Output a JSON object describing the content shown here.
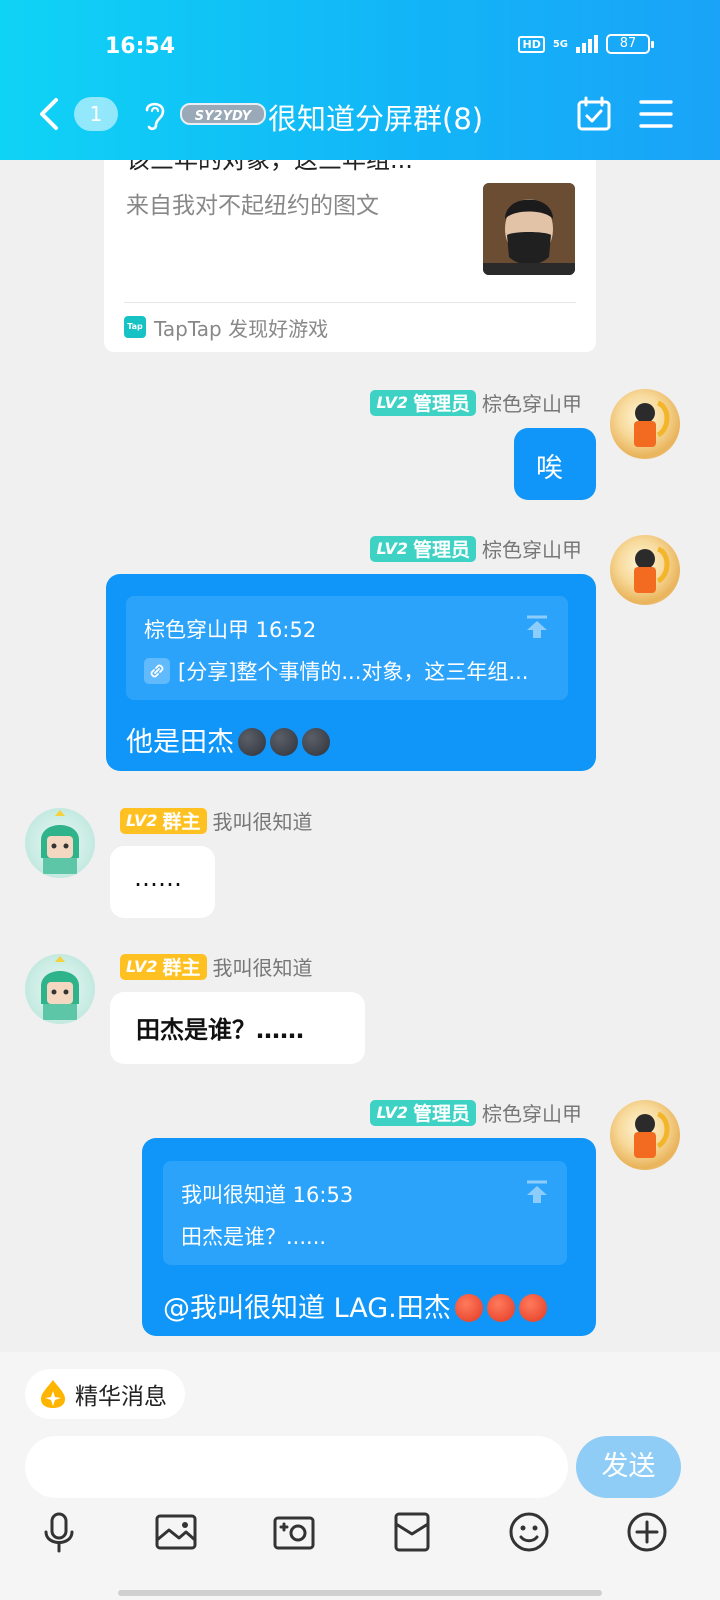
{
  "status_bar": {
    "time": "16:54",
    "hd": "HD",
    "network": "5G",
    "battery": "87"
  },
  "header": {
    "unread_count": "1",
    "group_title": "很知道分屏群(8)",
    "group_logo_text": "SY2YDY"
  },
  "colors": {
    "header_start": "#0fd3f5",
    "header_end": "#1aa3f8",
    "bubble_blue": "#0f96f8",
    "quote_blue": "#2ba3fa",
    "admin_badge": "#3dd2c4",
    "owner_badge": "#ffc122",
    "send_button": "#8fcdf7"
  },
  "shared_card": {
    "title": "该三年的对象，这三年组...",
    "description": "来自我对不起纽约的图文",
    "source_icon": "Tap",
    "source": "TapTap 发现好游戏"
  },
  "messages": [
    {
      "level": "LV2",
      "role": "管理员",
      "sender": "棕色穿山甲",
      "text": "唉"
    },
    {
      "level": "LV2",
      "role": "管理员",
      "sender": "棕色穿山甲",
      "quote_head": "棕色穿山甲 16:52",
      "quote_text": "[分享]整个事情的...对象，这三年组...",
      "text": "他是田杰"
    },
    {
      "level": "LV2",
      "role": "群主",
      "sender": "我叫很知道",
      "text": "……"
    },
    {
      "level": "LV2",
      "role": "群主",
      "sender": "我叫很知道",
      "text": "田杰是谁？……"
    },
    {
      "level": "LV2",
      "role": "管理员",
      "sender": "棕色穿山甲",
      "quote_head": "我叫很知道 16:53",
      "quote_text": "田杰是谁？......",
      "text": "@我叫很知道 LAG.田杰"
    }
  ],
  "bottom": {
    "essence_label": "精华消息",
    "input_placeholder": "",
    "send_label": "发送",
    "toolbar": [
      "microphone-icon",
      "image-icon",
      "camera-icon",
      "red-packet-icon",
      "emoji-icon",
      "plus-icon"
    ]
  }
}
